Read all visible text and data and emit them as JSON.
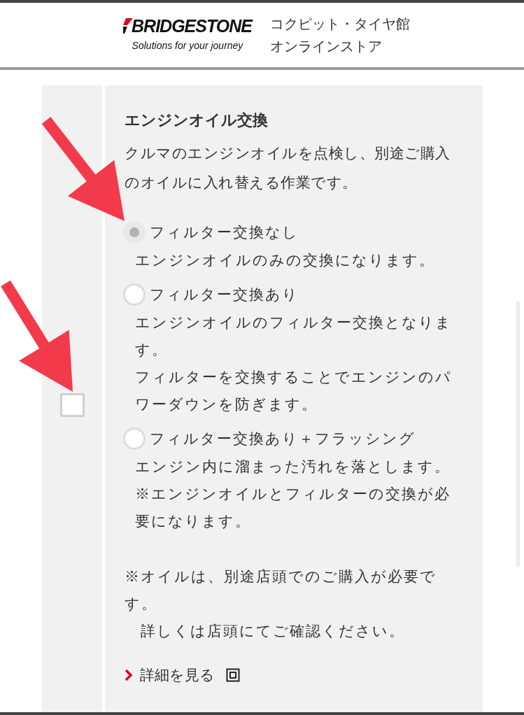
{
  "header": {
    "logo": {
      "wordmark": "BRIDGESTONE",
      "tagline": "Solutions for your journey"
    },
    "store_name": [
      "コクピット・タイヤ館",
      "オンラインストア"
    ]
  },
  "service": {
    "checked": false,
    "title": "エンジンオイル交換",
    "description": "クルマのエンジンオイルを点検し、別途ご購入のオイルに入れ替える作業です。",
    "options": [
      {
        "label": "フィルター交換なし",
        "selected": true,
        "details": [
          "エンジンオイルのみの交換になります。"
        ]
      },
      {
        "label": "フィルター交換あり",
        "selected": false,
        "details": [
          "エンジンオイルのフィルター交換となります。",
          "フィルターを交換することでエンジンのパワーダウンを防ぎます。"
        ]
      },
      {
        "label": "フィルター交換あり＋フラッシング",
        "selected": false,
        "details": [
          "エンジン内に溜まった汚れを落とします。",
          "※エンジンオイルとフィルターの交換が必要になります。"
        ]
      }
    ],
    "notes": [
      "※オイルは、別途店頭でのご購入が必要です。",
      "　詳しくは店頭にてご確認ください。"
    ],
    "link": "詳細を見る"
  }
}
